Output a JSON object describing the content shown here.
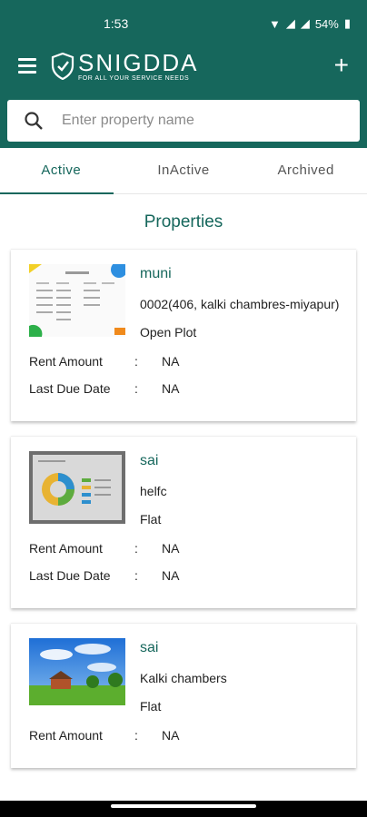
{
  "status_bar": {
    "time": "1:53",
    "battery": "54%"
  },
  "app": {
    "name": "SNIGDDA",
    "tagline": "FOR ALL YOUR SERVICE NEEDS"
  },
  "search": {
    "placeholder": "Enter property name",
    "value": ""
  },
  "tabs": [
    {
      "label": "Active",
      "active": true
    },
    {
      "label": "InActive",
      "active": false
    },
    {
      "label": "Archived",
      "active": false
    }
  ],
  "section_title": "Properties",
  "labels": {
    "rent_amount": "Rent Amount",
    "last_due_date": "Last Due Date",
    "separator": ":"
  },
  "properties": [
    {
      "name": "muni",
      "address": "0002(406, kalki chambres-miyapur)",
      "type": "Open Plot",
      "rent_amount": "NA",
      "last_due_date": "NA"
    },
    {
      "name": "sai",
      "address": "helfc",
      "type": "Flat",
      "rent_amount": "NA",
      "last_due_date": "NA"
    },
    {
      "name": "sai",
      "address": "Kalki chambers",
      "type": "Flat",
      "rent_amount": "NA",
      "last_due_date": ""
    }
  ],
  "colors": {
    "primary": "#16675c",
    "text": "#222222"
  }
}
